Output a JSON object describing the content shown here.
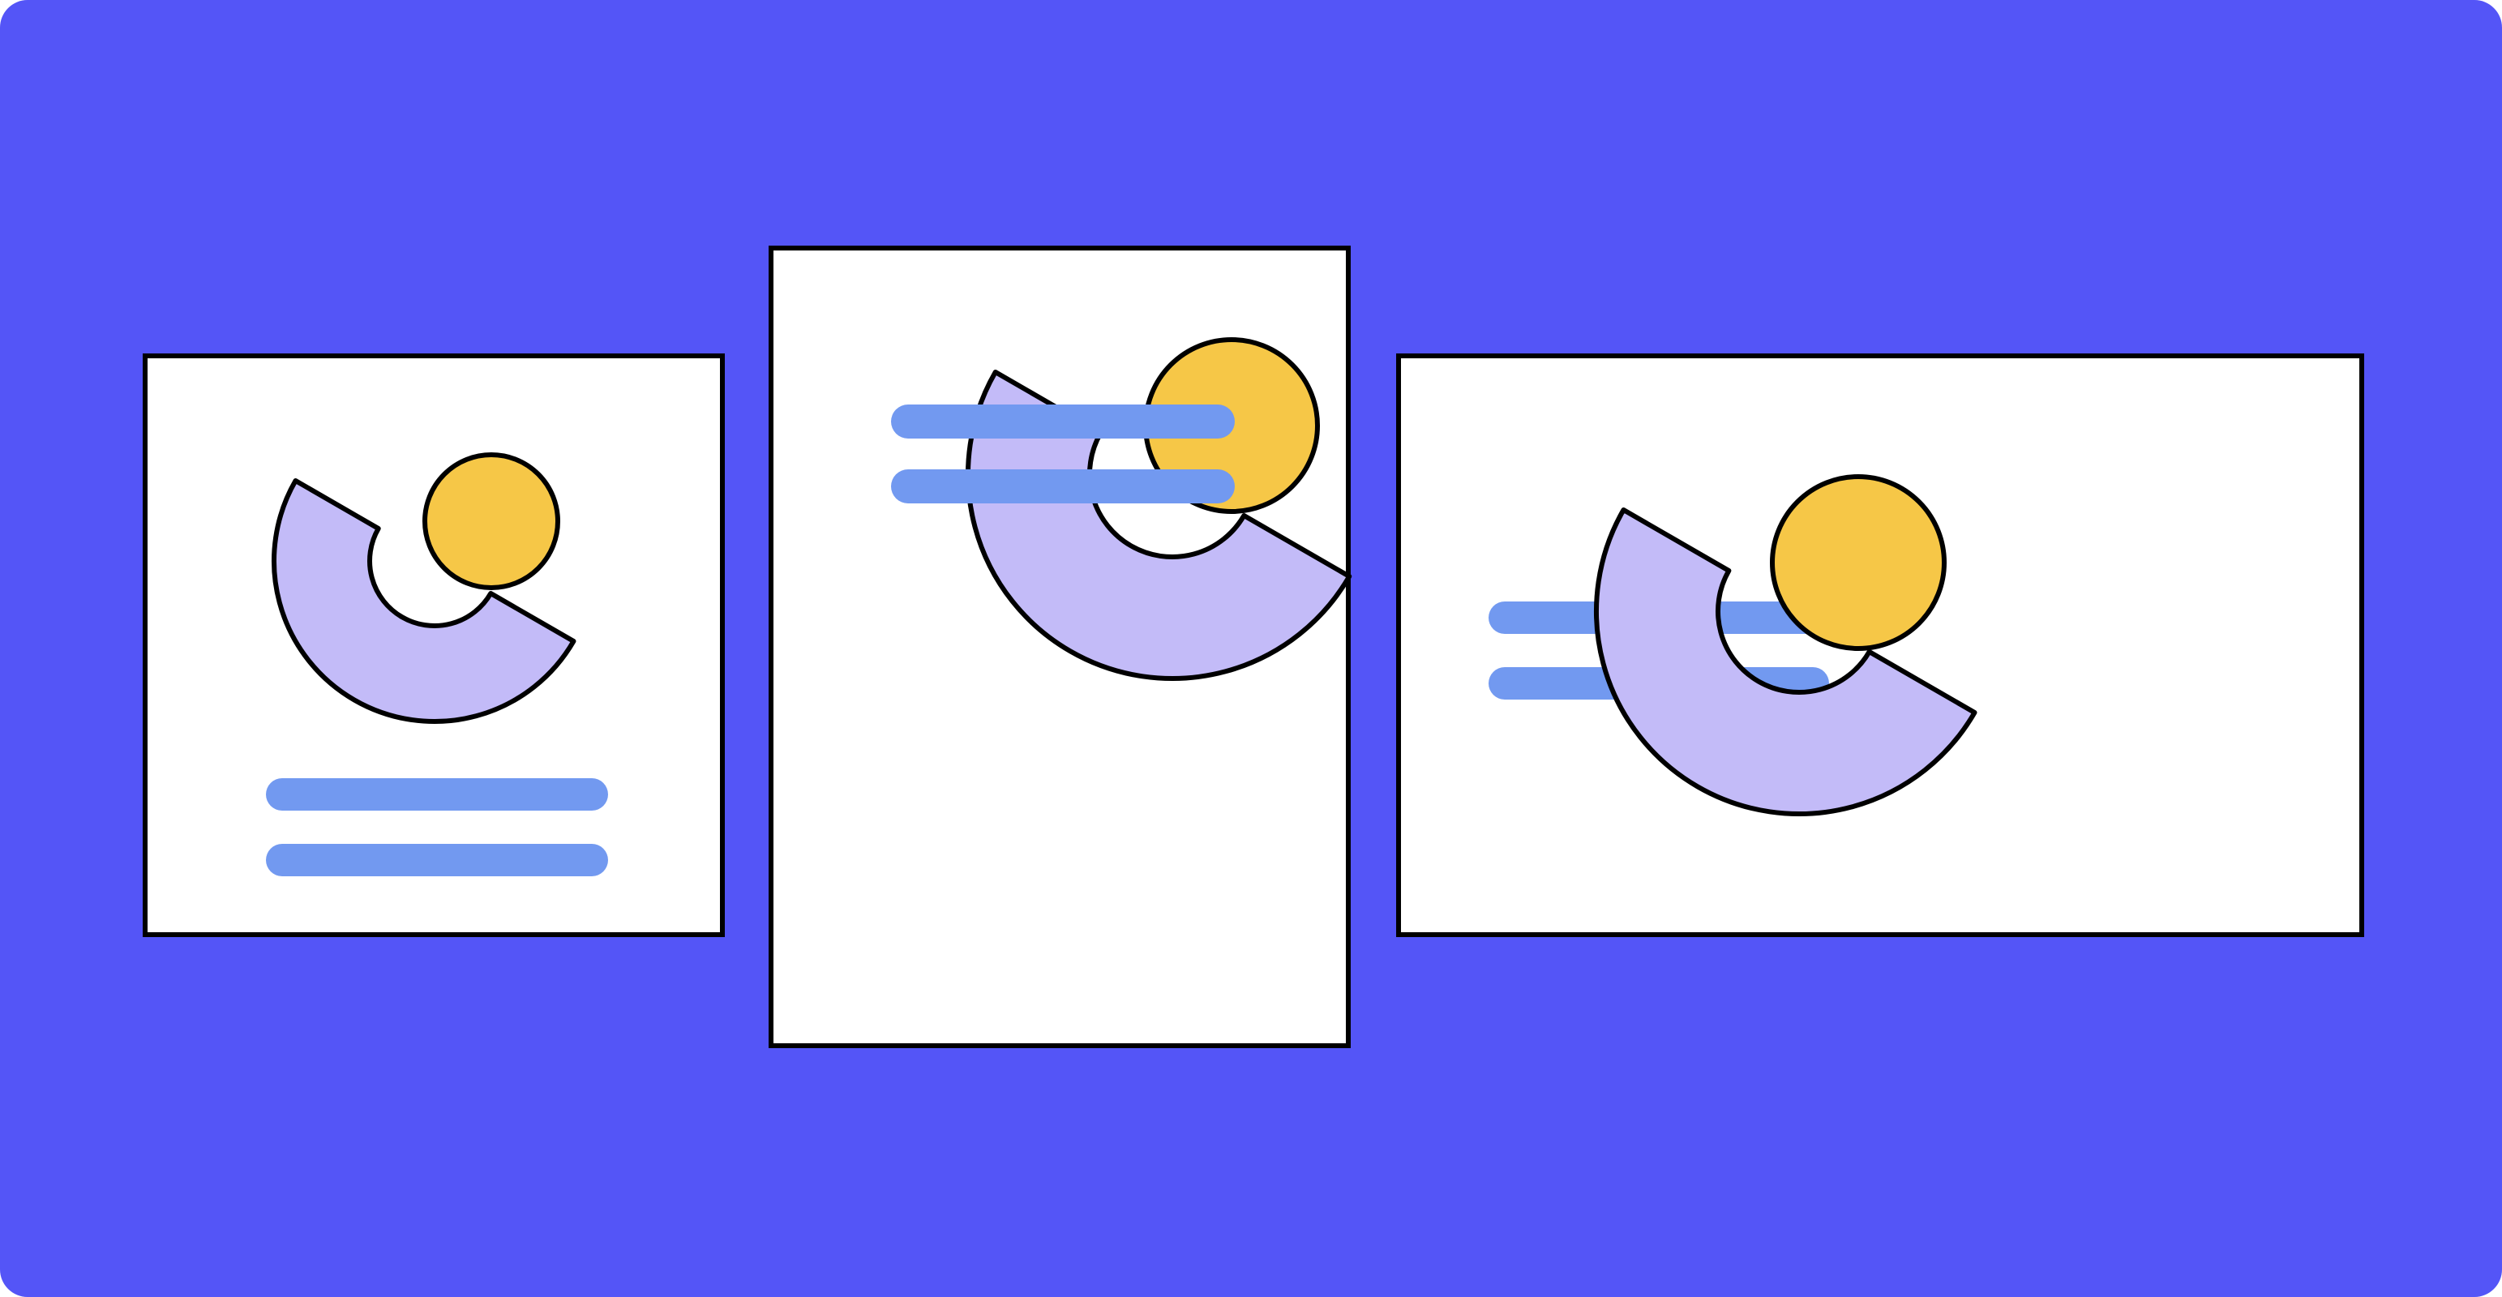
{
  "colors": {
    "background": "#5455F7",
    "card": "#FFFFFF",
    "outline": "#000000",
    "text_bar": "#7299F0",
    "arc": "#C3BBF8",
    "circle": "#F6C747"
  },
  "cards": [
    {
      "name": "square",
      "icon": "image-placeholder-icon",
      "text_lines": 2,
      "text_position": "below"
    },
    {
      "name": "portrait",
      "icon": "image-placeholder-icon",
      "text_lines": 2,
      "text_position": "above"
    },
    {
      "name": "landscape",
      "icon": "image-placeholder-icon",
      "text_lines": 2,
      "text_position": "left"
    }
  ]
}
